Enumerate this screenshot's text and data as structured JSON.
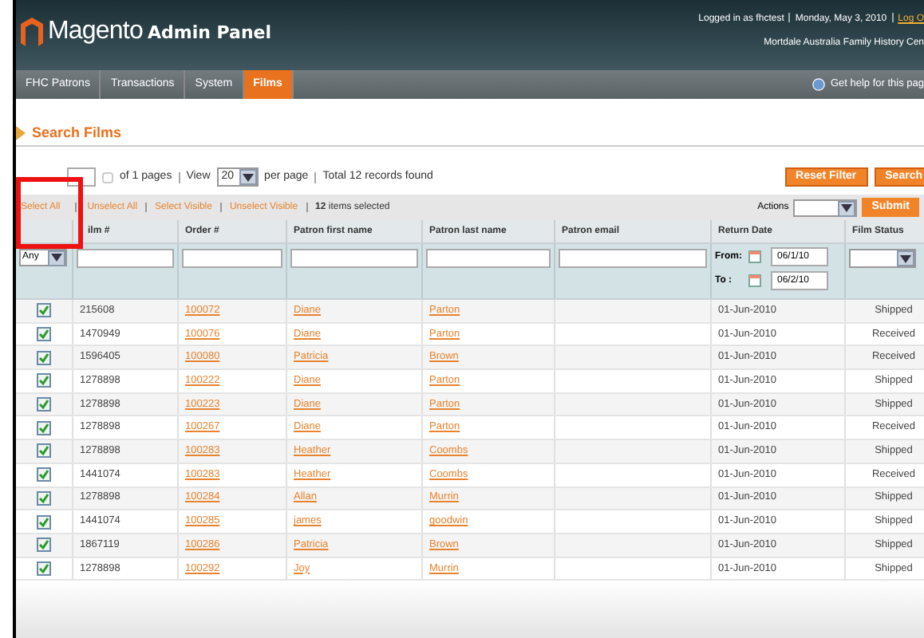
{
  "header": {
    "logo": "Magento",
    "logo_sub": "Admin Panel",
    "user_line": [
      "Logged in as fhctest",
      "Monday, May 3, 2010"
    ],
    "logout": "Log O",
    "store": "Mortdale Australia Family History Cen"
  },
  "nav": [
    {
      "label": "FHC Patrons",
      "selected": false
    },
    {
      "label": "Transactions",
      "selected": false
    },
    {
      "label": "System",
      "selected": false
    },
    {
      "label": "Films",
      "selected": true
    }
  ],
  "help": "Get help for this pag",
  "page_title": "Search Films",
  "pager": {
    "of_pages": "of 1 pages",
    "view": "View",
    "per_page_value": "20",
    "per_page": "per page",
    "total": "Total 12 records found"
  },
  "buttons": [
    "Reset Filter",
    "Search"
  ],
  "massaction": {
    "links": [
      "Select All",
      "Unselect All",
      "Select Visible",
      "Unselect Visible"
    ],
    "count": "12",
    "count_label": "items selected",
    "actions": "Actions",
    "submit": "Submit"
  },
  "columns": [
    "ilm #",
    "Order #",
    "Patron first name",
    "Patron last name",
    "Patron email",
    "Return Date",
    "Film Status"
  ],
  "filters": {
    "any": "Any",
    "from": "From:",
    "from_value": "06/1/10",
    "to": "To :",
    "to_value": "06/2/10"
  },
  "rows": [
    {
      "checked": true,
      "film": "215608",
      "order": "100072",
      "first": "Diane",
      "last": "Parton",
      "date": "01-Jun-2010",
      "status": "Shipped"
    },
    {
      "checked": true,
      "film": "1470949",
      "order": "100076",
      "first": "Diane",
      "last": "Parton",
      "date": "01-Jun-2010",
      "status": "Received"
    },
    {
      "checked": true,
      "film": "1596405",
      "order": "100080",
      "first": "Patricia",
      "last": "Brown",
      "date": "01-Jun-2010",
      "status": "Received"
    },
    {
      "checked": true,
      "film": "1278898",
      "order": "100222",
      "first": "Diane",
      "last": "Parton",
      "date": "01-Jun-2010",
      "status": "Shipped"
    },
    {
      "checked": true,
      "film": "1278898",
      "order": "100223",
      "first": "Diane",
      "last": "Parton",
      "date": "01-Jun-2010",
      "status": "Shipped"
    },
    {
      "checked": true,
      "film": "1278898",
      "order": "100267",
      "first": "Diane",
      "last": "Parton",
      "date": "01-Jun-2010",
      "status": "Received"
    },
    {
      "checked": true,
      "film": "1278898",
      "order": "100283",
      "first": "Heather",
      "last": "Coombs",
      "date": "01-Jun-2010",
      "status": "Shipped"
    },
    {
      "checked": true,
      "film": "1441074",
      "order": "100283",
      "first": "Heather",
      "last": "Coombs",
      "date": "01-Jun-2010",
      "status": "Received"
    },
    {
      "checked": true,
      "film": "1278898",
      "order": "100284",
      "first": "Allan",
      "last": "Murrin",
      "date": "01-Jun-2010",
      "status": "Shipped"
    },
    {
      "checked": true,
      "film": "1441074",
      "order": "100285",
      "first": "james",
      "last": "goodwin",
      "date": "01-Jun-2010",
      "status": "Shipped"
    },
    {
      "checked": true,
      "film": "1867119",
      "order": "100286",
      "first": "Patricia",
      "last": "Brown",
      "date": "01-Jun-2010",
      "status": "Shipped"
    },
    {
      "checked": true,
      "film": "1278898",
      "order": "100292",
      "first": "Joy",
      "last": "Murrin",
      "date": "01-Jun-2010",
      "status": "Shipped"
    }
  ]
}
